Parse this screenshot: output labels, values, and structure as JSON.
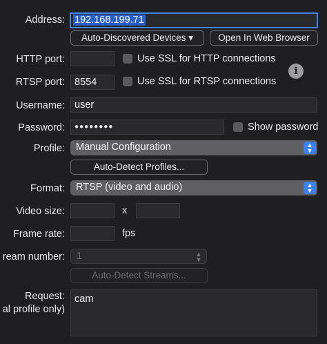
{
  "labels": {
    "address": "Address:",
    "http_port": "HTTP port:",
    "rtsp_port": "RTSP port:",
    "username": "Username:",
    "password": "Password:",
    "profile": "Profile:",
    "format": "Format:",
    "video_size": "Video size:",
    "frame_rate": "Frame rate:",
    "stream_number": "ream number:",
    "request_line1": "Request:",
    "request_line2": "al profile only)"
  },
  "fields": {
    "address": "192.168.199.71",
    "http_port": "",
    "rtsp_port": "8554",
    "username": "user",
    "password_mask": "●●●●●●●●",
    "video_width": "",
    "video_height": "",
    "frame_rate": "",
    "stream_number": "1",
    "request": "cam"
  },
  "buttons": {
    "auto_discovered": "Auto-Discovered Devices ▾",
    "open_browser": "Open In Web Browser",
    "auto_detect_profiles": "Auto-Detect Profiles...",
    "auto_detect_streams": "Auto-Detect Streams..."
  },
  "checkboxes": {
    "ssl_http": "Use SSL for HTTP connections",
    "ssl_rtsp": "Use SSL for RTSP connections",
    "show_password": "Show password"
  },
  "popups": {
    "profile": "Manual Configuration",
    "format": "RTSP (video and audio)"
  },
  "units": {
    "size_separator": "x",
    "fps": "fps"
  },
  "icons": {
    "info": "info-icon",
    "popup_arrows": "up-down-chevron-icon"
  }
}
